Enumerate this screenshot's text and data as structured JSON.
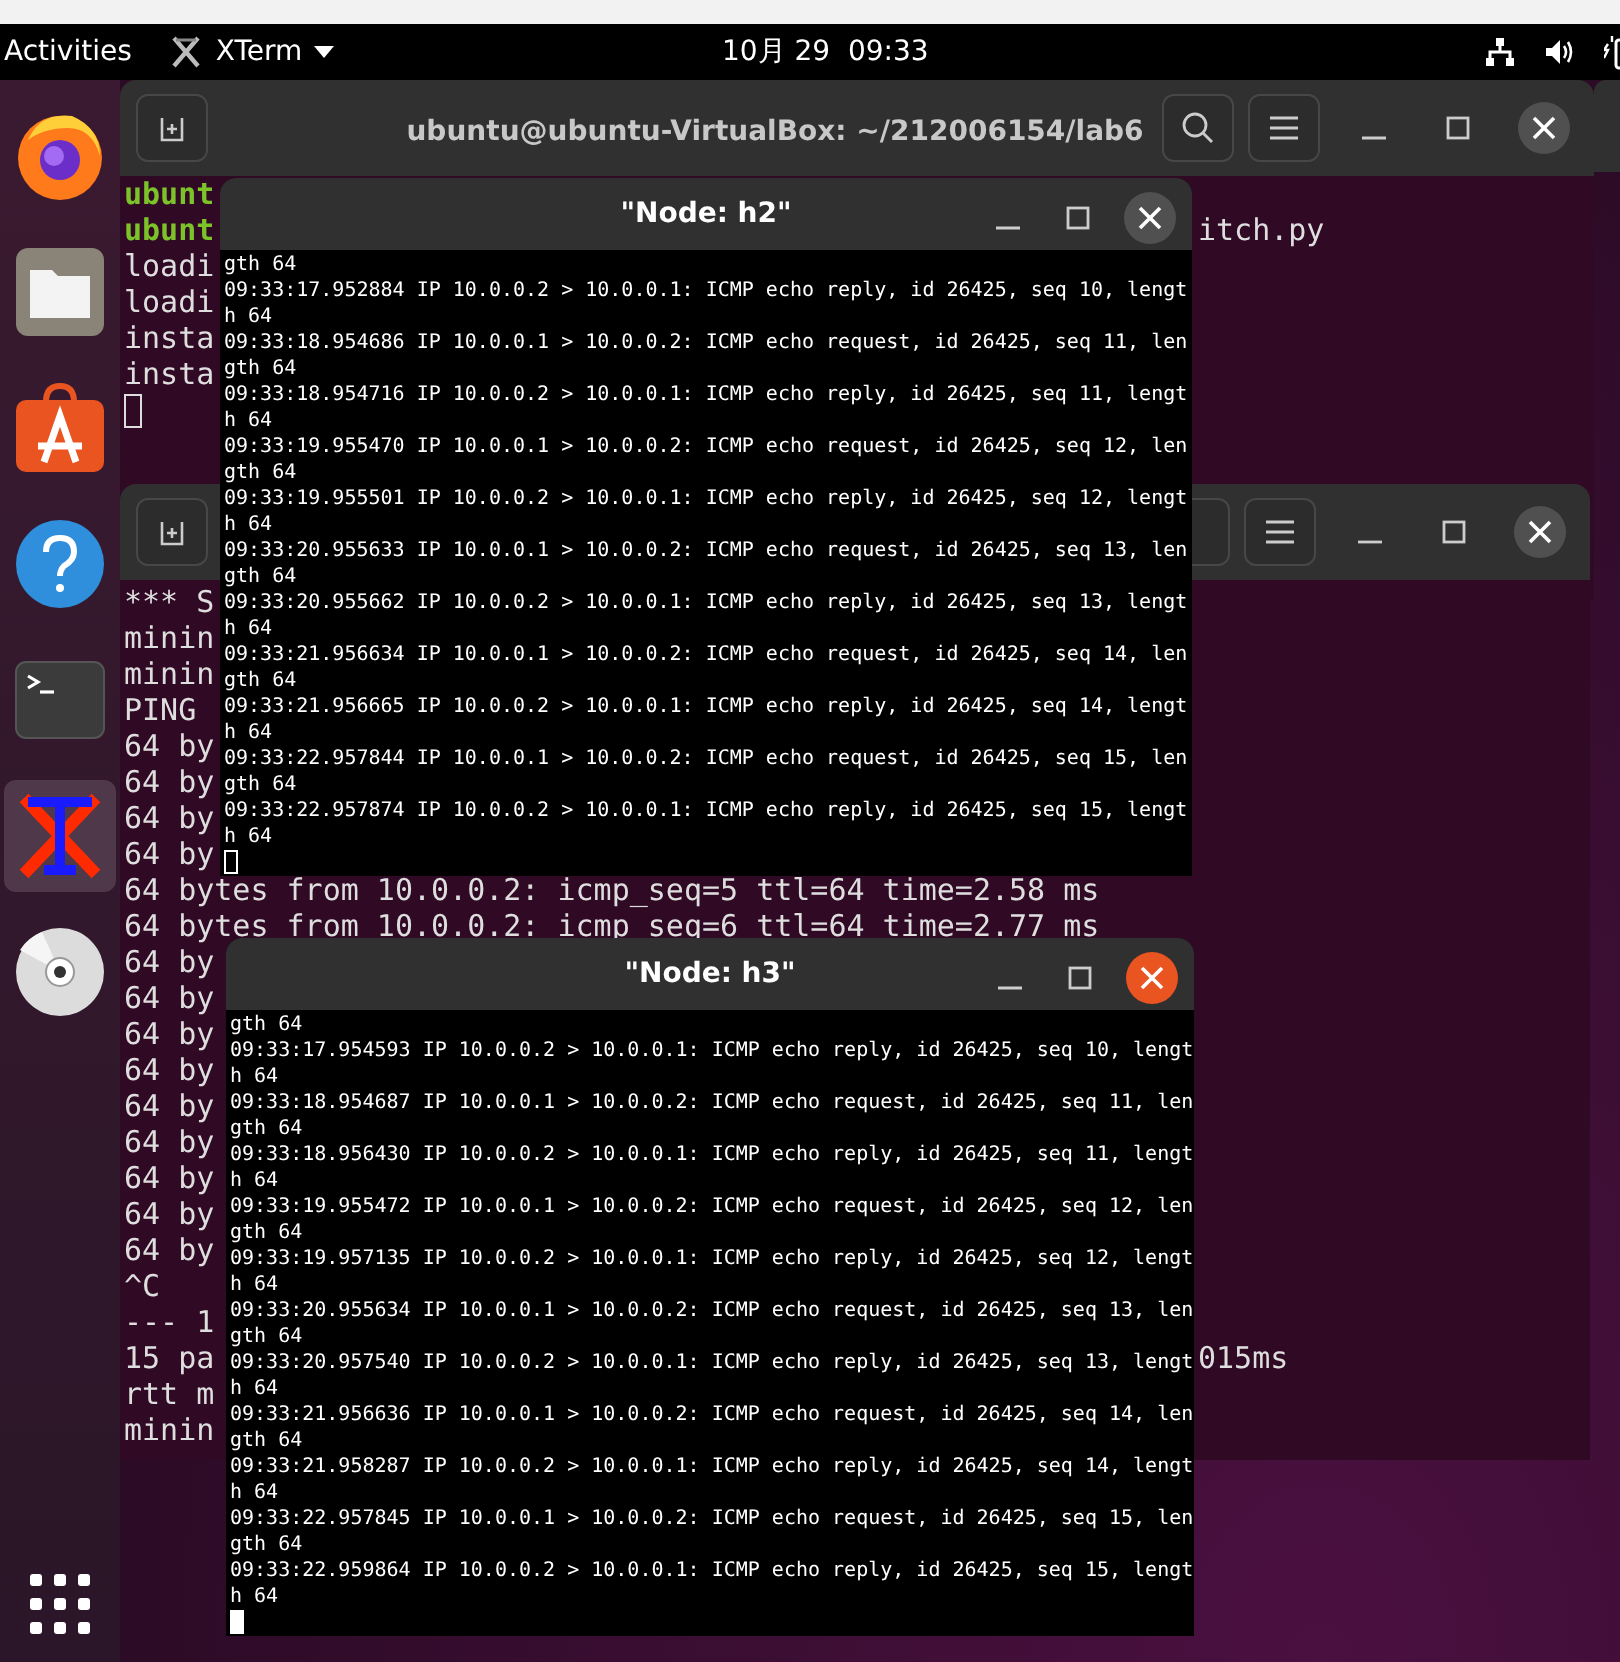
{
  "top_bar": {
    "activities": "Activities",
    "app_menu": "XTerm",
    "clock": "10月 29  09:33"
  },
  "dock": {
    "items": [
      {
        "kind": "firefox",
        "selected": false
      },
      {
        "kind": "files",
        "selected": false
      },
      {
        "kind": "software",
        "selected": false
      },
      {
        "kind": "help",
        "selected": false
      },
      {
        "kind": "terminal",
        "selected": false
      },
      {
        "kind": "xterm",
        "selected": true
      },
      {
        "kind": "disc",
        "selected": false
      }
    ]
  },
  "windows": [
    {
      "kind": "terminal",
      "title": "ubuntu@ubuntu-VirtualBox: ~/212006154/lab6",
      "cursor": true,
      "lines": [
        {
          "kind": "prompt",
          "text": "ubunt"
        },
        {
          "kind": "prompt",
          "text": "ubunt",
          "right": "itch.py"
        },
        {
          "kind": "output",
          "text": "loadi"
        },
        {
          "kind": "output",
          "text": "loadi"
        },
        {
          "kind": "output",
          "text": "insta"
        },
        {
          "kind": "output",
          "text": "insta"
        }
      ]
    },
    {
      "kind": "terminal",
      "cursor": false,
      "lines": [
        {
          "kind": "output",
          "text": "*** S"
        },
        {
          "kind": "output",
          "text": "minin"
        },
        {
          "kind": "output",
          "text": "minin"
        },
        {
          "kind": "output",
          "text": "PING"
        },
        {
          "kind": "output",
          "text": "64 by"
        },
        {
          "kind": "output",
          "text": "64 by"
        },
        {
          "kind": "output",
          "text": "64 by"
        },
        {
          "kind": "output",
          "text": "64 by"
        },
        {
          "kind": "output",
          "text": "64 bytes from 10.0.0.2: icmp_seq=5 ttl=64 time=2.58 ms"
        },
        {
          "kind": "output",
          "text": "64 bytes from 10.0.0.2: icmp_seq=6 ttl=64 time=2.77 ms"
        },
        {
          "kind": "output",
          "text": "64 by"
        },
        {
          "kind": "output",
          "text": "64 by"
        },
        {
          "kind": "output",
          "text": "64 by"
        },
        {
          "kind": "output",
          "text": "64 by"
        },
        {
          "kind": "output",
          "text": "64 by"
        },
        {
          "kind": "output",
          "text": "64 by"
        },
        {
          "kind": "output",
          "text": "64 by"
        },
        {
          "kind": "output",
          "text": "64 by"
        },
        {
          "kind": "output",
          "text": "64 by"
        },
        {
          "kind": "output",
          "text": "^C"
        },
        {
          "kind": "output",
          "text": "--- 1"
        },
        {
          "kind": "output",
          "text": "15 pa",
          "right": "015ms"
        },
        {
          "kind": "output",
          "text": "rtt m"
        },
        {
          "kind": "output",
          "text": "minin"
        }
      ]
    },
    {
      "kind": "xterm",
      "title": "\"Node: h2\"",
      "focused": false,
      "lines": [
        "gth 64",
        "09:33:17.952884 IP 10.0.0.2 > 10.0.0.1: ICMP echo reply, id 26425, seq 10, lengt",
        "h 64",
        "09:33:18.954686 IP 10.0.0.1 > 10.0.0.2: ICMP echo request, id 26425, seq 11, len",
        "gth 64",
        "09:33:18.954716 IP 10.0.0.2 > 10.0.0.1: ICMP echo reply, id 26425, seq 11, lengt",
        "h 64",
        "09:33:19.955470 IP 10.0.0.1 > 10.0.0.2: ICMP echo request, id 26425, seq 12, len",
        "gth 64",
        "09:33:19.955501 IP 10.0.0.2 > 10.0.0.1: ICMP echo reply, id 26425, seq 12, lengt",
        "h 64",
        "09:33:20.955633 IP 10.0.0.1 > 10.0.0.2: ICMP echo request, id 26425, seq 13, len",
        "gth 64",
        "09:33:20.955662 IP 10.0.0.2 > 10.0.0.1: ICMP echo reply, id 26425, seq 13, lengt",
        "h 64",
        "09:33:21.956634 IP 10.0.0.1 > 10.0.0.2: ICMP echo request, id 26425, seq 14, len",
        "gth 64",
        "09:33:21.956665 IP 10.0.0.2 > 10.0.0.1: ICMP echo reply, id 26425, seq 14, lengt",
        "h 64",
        "09:33:22.957844 IP 10.0.0.1 > 10.0.0.2: ICMP echo request, id 26425, seq 15, len",
        "gth 64",
        "09:33:22.957874 IP 10.0.0.2 > 10.0.0.1: ICMP echo reply, id 26425, seq 15, lengt",
        "h 64"
      ]
    },
    {
      "kind": "xterm",
      "title": "\"Node: h3\"",
      "focused": true,
      "lines": [
        "gth 64",
        "09:33:17.954593 IP 10.0.0.2 > 10.0.0.1: ICMP echo reply, id 26425, seq 10, lengt",
        "h 64",
        "09:33:18.954687 IP 10.0.0.1 > 10.0.0.2: ICMP echo request, id 26425, seq 11, len",
        "gth 64",
        "09:33:18.956430 IP 10.0.0.2 > 10.0.0.1: ICMP echo reply, id 26425, seq 11, lengt",
        "h 64",
        "09:33:19.955472 IP 10.0.0.1 > 10.0.0.2: ICMP echo request, id 26425, seq 12, len",
        "gth 64",
        "09:33:19.957135 IP 10.0.0.2 > 10.0.0.1: ICMP echo reply, id 26425, seq 12, lengt",
        "h 64",
        "09:33:20.955634 IP 10.0.0.1 > 10.0.0.2: ICMP echo request, id 26425, seq 13, len",
        "gth 64",
        "09:33:20.957540 IP 10.0.0.2 > 10.0.0.1: ICMP echo reply, id 26425, seq 13, lengt",
        "h 64",
        "09:33:21.956636 IP 10.0.0.1 > 10.0.0.2: ICMP echo request, id 26425, seq 14, len",
        "gth 64",
        "09:33:21.958287 IP 10.0.0.2 > 10.0.0.1: ICMP echo reply, id 26425, seq 14, lengt",
        "h 64",
        "09:33:22.957845 IP 10.0.0.1 > 10.0.0.2: ICMP echo request, id 26425, seq 15, len",
        "gth 64",
        "09:33:22.959864 IP 10.0.0.2 > 10.0.0.1: ICMP echo reply, id 26425, seq 15, lengt",
        "h 64"
      ]
    }
  ]
}
